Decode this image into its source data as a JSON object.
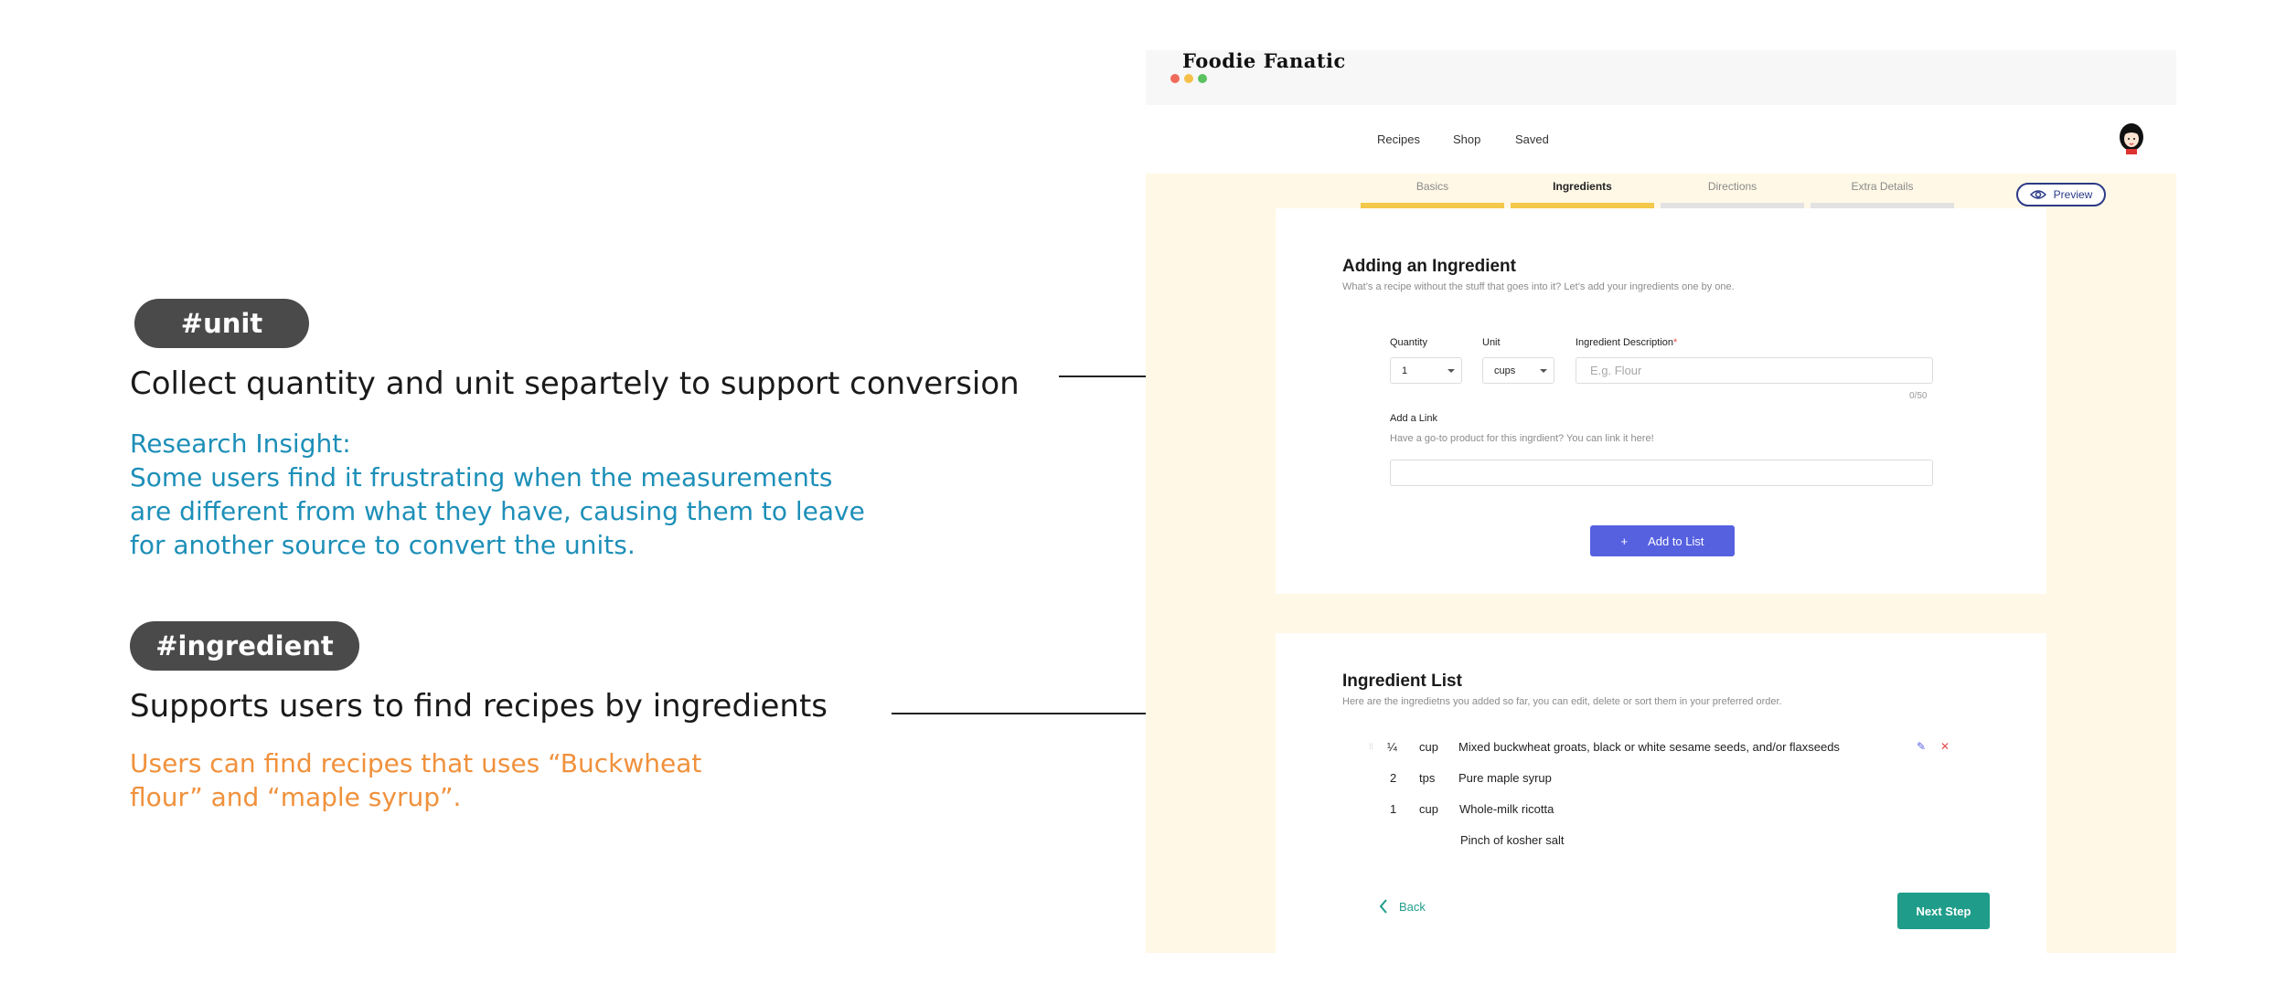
{
  "annotations": {
    "unit": {
      "tag": "#unit",
      "title": "Collect quantity and unit separtely to support conversion",
      "insight_lines": [
        "Research Insight:",
        "Some users find it frustrating when the measurements",
        "are different from what they have, causing them to leave",
        "for another source to convert the units."
      ]
    },
    "ingredient": {
      "tag": "#ingredient",
      "title": "Supports users to find recipes by ingredients",
      "note_lines": [
        "Users can find recipes that uses “Buckwheat",
        "flour” and  “maple syrup”."
      ]
    },
    "colors": {
      "tag_bg": "#4a4a4a",
      "insight": "#1d8fb8",
      "note": "#f0913c"
    }
  },
  "app": {
    "logo": "Foodie Fanatic",
    "nav": [
      "Recipes",
      "Shop",
      "Saved"
    ],
    "steps": [
      {
        "label": "Basics",
        "active": false,
        "done": true
      },
      {
        "label": "Ingredients",
        "active": true,
        "done": true
      },
      {
        "label": "Directions",
        "active": false,
        "done": false
      },
      {
        "label": "Extra Details",
        "active": false,
        "done": false
      }
    ],
    "preview_label": "Preview",
    "add_card": {
      "title": "Adding an Ingredient",
      "subtitle": "What’s a recipe without the stuff that goes into it? Let’s add your ingredients one by one.",
      "quantity_label": "Quantity",
      "quantity_value": "1",
      "unit_label": "Unit",
      "unit_value": "cups",
      "description_label": "Ingredient Description",
      "required_mark": "*",
      "description_placeholder": "E.g. Flour",
      "counter": "0/50",
      "link_label": "Add a Link",
      "link_helper": "Have a go-to product for this ingrdient? You can link it here!",
      "link_value": "",
      "add_button_icon": "+",
      "add_button": "Add to List"
    },
    "list_card": {
      "title": "Ingredient List",
      "subtitle": "Here are the ingredietns you added so far,  you can edit, delete or sort them in your preferred order.",
      "items": [
        {
          "qty": "¼",
          "unit": "cup",
          "desc": "Mixed buckwheat groats, black or white sesame seeds, and/or flaxseeds",
          "hovered": true
        },
        {
          "qty": "2",
          "unit": "tps",
          "desc": "Pure maple syrup",
          "hovered": false
        },
        {
          "qty": "1",
          "unit": "cup",
          "desc": "Whole-milk ricotta",
          "hovered": false
        },
        {
          "qty": "",
          "unit": "",
          "desc": "Pinch of kosher salt",
          "hovered": false
        }
      ],
      "back_label": "Back",
      "next_label": "Next Step"
    },
    "colors": {
      "accent_yellow": "#f4c84a",
      "primary": "#5661e0",
      "teal": "#1f9d8a",
      "danger": "#e34b4b",
      "background": "#fff8e6"
    }
  }
}
